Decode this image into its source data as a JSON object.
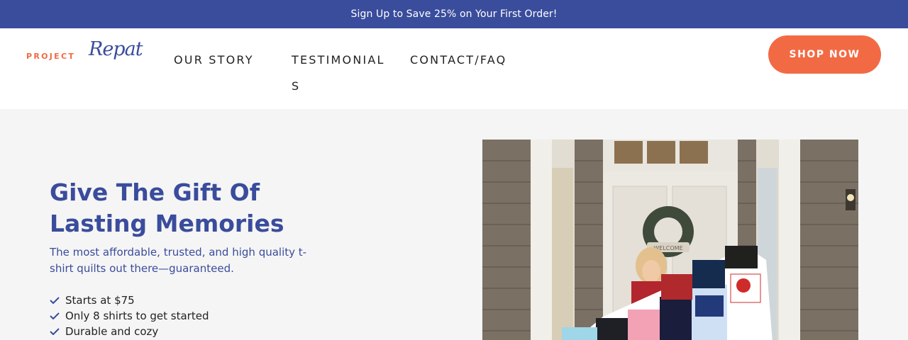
{
  "promo_bar": {
    "text": "Sign Up to Save 25% on Your First Order!"
  },
  "brand": {
    "word1": "PROJECT",
    "word2": "Repat"
  },
  "nav": {
    "items": [
      {
        "label": "OUR STORY"
      },
      {
        "label": "TESTIMONIALS"
      },
      {
        "label": "CONTACT/FAQ"
      }
    ],
    "cta_label": "SHOP NOW"
  },
  "hero": {
    "title": "Give The Gift Of Lasting Memories",
    "subtitle": "The most affordable, trusted, and high quality t-shirt quilts out there—guaranteed.",
    "features": [
      "Starts at $75",
      "Only 8 shirts to get started",
      "Durable and cozy"
    ],
    "check_icon": "check-icon",
    "photo_sign_text": "WELCOME"
  },
  "colors": {
    "brand_blue": "#3a4c9c",
    "brand_orange": "#f26a44",
    "hero_bg": "#f5f5f5"
  }
}
